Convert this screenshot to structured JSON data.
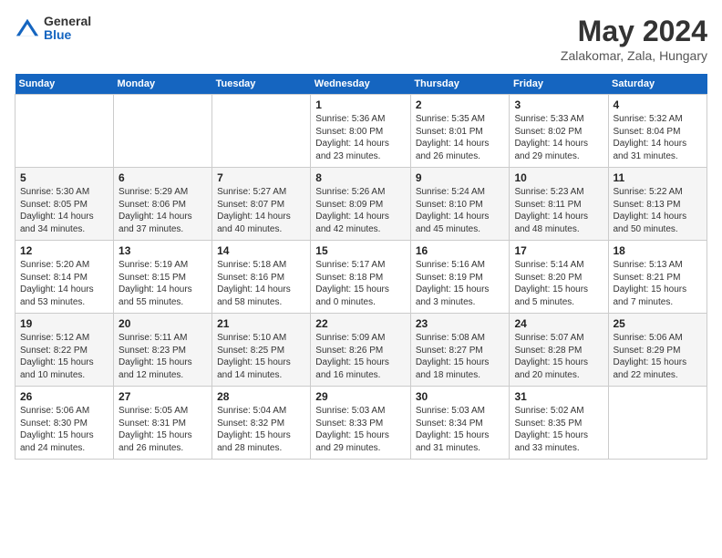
{
  "logo": {
    "general": "General",
    "blue": "Blue"
  },
  "title": "May 2024",
  "location": "Zalakomar, Zala, Hungary",
  "weekdays": [
    "Sunday",
    "Monday",
    "Tuesday",
    "Wednesday",
    "Thursday",
    "Friday",
    "Saturday"
  ],
  "weeks": [
    [
      {
        "day": "",
        "sunrise": "",
        "sunset": "",
        "daylight": ""
      },
      {
        "day": "",
        "sunrise": "",
        "sunset": "",
        "daylight": ""
      },
      {
        "day": "",
        "sunrise": "",
        "sunset": "",
        "daylight": ""
      },
      {
        "day": "1",
        "sunrise": "Sunrise: 5:36 AM",
        "sunset": "Sunset: 8:00 PM",
        "daylight": "Daylight: 14 hours and 23 minutes."
      },
      {
        "day": "2",
        "sunrise": "Sunrise: 5:35 AM",
        "sunset": "Sunset: 8:01 PM",
        "daylight": "Daylight: 14 hours and 26 minutes."
      },
      {
        "day": "3",
        "sunrise": "Sunrise: 5:33 AM",
        "sunset": "Sunset: 8:02 PM",
        "daylight": "Daylight: 14 hours and 29 minutes."
      },
      {
        "day": "4",
        "sunrise": "Sunrise: 5:32 AM",
        "sunset": "Sunset: 8:04 PM",
        "daylight": "Daylight: 14 hours and 31 minutes."
      }
    ],
    [
      {
        "day": "5",
        "sunrise": "Sunrise: 5:30 AM",
        "sunset": "Sunset: 8:05 PM",
        "daylight": "Daylight: 14 hours and 34 minutes."
      },
      {
        "day": "6",
        "sunrise": "Sunrise: 5:29 AM",
        "sunset": "Sunset: 8:06 PM",
        "daylight": "Daylight: 14 hours and 37 minutes."
      },
      {
        "day": "7",
        "sunrise": "Sunrise: 5:27 AM",
        "sunset": "Sunset: 8:07 PM",
        "daylight": "Daylight: 14 hours and 40 minutes."
      },
      {
        "day": "8",
        "sunrise": "Sunrise: 5:26 AM",
        "sunset": "Sunset: 8:09 PM",
        "daylight": "Daylight: 14 hours and 42 minutes."
      },
      {
        "day": "9",
        "sunrise": "Sunrise: 5:24 AM",
        "sunset": "Sunset: 8:10 PM",
        "daylight": "Daylight: 14 hours and 45 minutes."
      },
      {
        "day": "10",
        "sunrise": "Sunrise: 5:23 AM",
        "sunset": "Sunset: 8:11 PM",
        "daylight": "Daylight: 14 hours and 48 minutes."
      },
      {
        "day": "11",
        "sunrise": "Sunrise: 5:22 AM",
        "sunset": "Sunset: 8:13 PM",
        "daylight": "Daylight: 14 hours and 50 minutes."
      }
    ],
    [
      {
        "day": "12",
        "sunrise": "Sunrise: 5:20 AM",
        "sunset": "Sunset: 8:14 PM",
        "daylight": "Daylight: 14 hours and 53 minutes."
      },
      {
        "day": "13",
        "sunrise": "Sunrise: 5:19 AM",
        "sunset": "Sunset: 8:15 PM",
        "daylight": "Daylight: 14 hours and 55 minutes."
      },
      {
        "day": "14",
        "sunrise": "Sunrise: 5:18 AM",
        "sunset": "Sunset: 8:16 PM",
        "daylight": "Daylight: 14 hours and 58 minutes."
      },
      {
        "day": "15",
        "sunrise": "Sunrise: 5:17 AM",
        "sunset": "Sunset: 8:18 PM",
        "daylight": "Daylight: 15 hours and 0 minutes."
      },
      {
        "day": "16",
        "sunrise": "Sunrise: 5:16 AM",
        "sunset": "Sunset: 8:19 PM",
        "daylight": "Daylight: 15 hours and 3 minutes."
      },
      {
        "day": "17",
        "sunrise": "Sunrise: 5:14 AM",
        "sunset": "Sunset: 8:20 PM",
        "daylight": "Daylight: 15 hours and 5 minutes."
      },
      {
        "day": "18",
        "sunrise": "Sunrise: 5:13 AM",
        "sunset": "Sunset: 8:21 PM",
        "daylight": "Daylight: 15 hours and 7 minutes."
      }
    ],
    [
      {
        "day": "19",
        "sunrise": "Sunrise: 5:12 AM",
        "sunset": "Sunset: 8:22 PM",
        "daylight": "Daylight: 15 hours and 10 minutes."
      },
      {
        "day": "20",
        "sunrise": "Sunrise: 5:11 AM",
        "sunset": "Sunset: 8:23 PM",
        "daylight": "Daylight: 15 hours and 12 minutes."
      },
      {
        "day": "21",
        "sunrise": "Sunrise: 5:10 AM",
        "sunset": "Sunset: 8:25 PM",
        "daylight": "Daylight: 15 hours and 14 minutes."
      },
      {
        "day": "22",
        "sunrise": "Sunrise: 5:09 AM",
        "sunset": "Sunset: 8:26 PM",
        "daylight": "Daylight: 15 hours and 16 minutes."
      },
      {
        "day": "23",
        "sunrise": "Sunrise: 5:08 AM",
        "sunset": "Sunset: 8:27 PM",
        "daylight": "Daylight: 15 hours and 18 minutes."
      },
      {
        "day": "24",
        "sunrise": "Sunrise: 5:07 AM",
        "sunset": "Sunset: 8:28 PM",
        "daylight": "Daylight: 15 hours and 20 minutes."
      },
      {
        "day": "25",
        "sunrise": "Sunrise: 5:06 AM",
        "sunset": "Sunset: 8:29 PM",
        "daylight": "Daylight: 15 hours and 22 minutes."
      }
    ],
    [
      {
        "day": "26",
        "sunrise": "Sunrise: 5:06 AM",
        "sunset": "Sunset: 8:30 PM",
        "daylight": "Daylight: 15 hours and 24 minutes."
      },
      {
        "day": "27",
        "sunrise": "Sunrise: 5:05 AM",
        "sunset": "Sunset: 8:31 PM",
        "daylight": "Daylight: 15 hours and 26 minutes."
      },
      {
        "day": "28",
        "sunrise": "Sunrise: 5:04 AM",
        "sunset": "Sunset: 8:32 PM",
        "daylight": "Daylight: 15 hours and 28 minutes."
      },
      {
        "day": "29",
        "sunrise": "Sunrise: 5:03 AM",
        "sunset": "Sunset: 8:33 PM",
        "daylight": "Daylight: 15 hours and 29 minutes."
      },
      {
        "day": "30",
        "sunrise": "Sunrise: 5:03 AM",
        "sunset": "Sunset: 8:34 PM",
        "daylight": "Daylight: 15 hours and 31 minutes."
      },
      {
        "day": "31",
        "sunrise": "Sunrise: 5:02 AM",
        "sunset": "Sunset: 8:35 PM",
        "daylight": "Daylight: 15 hours and 33 minutes."
      },
      {
        "day": "",
        "sunrise": "",
        "sunset": "",
        "daylight": ""
      }
    ]
  ]
}
